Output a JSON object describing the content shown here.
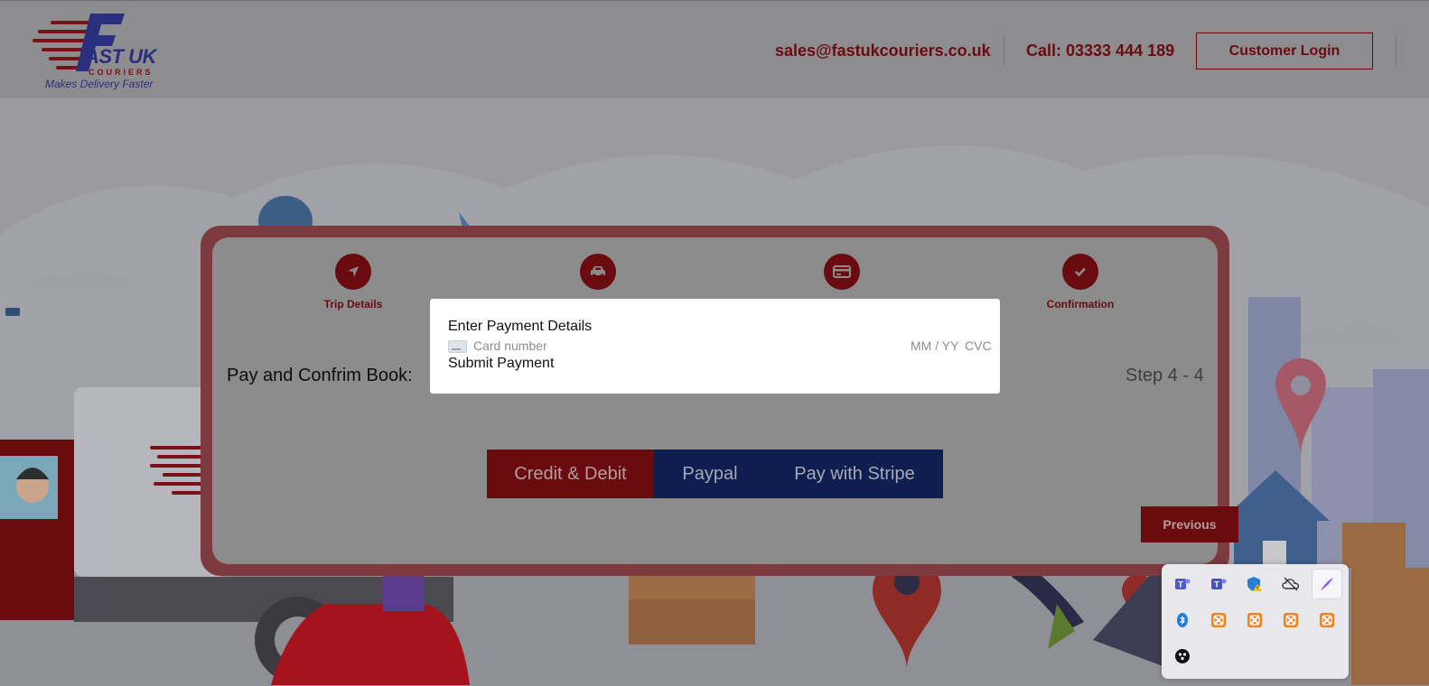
{
  "header": {
    "logo_brand": "AST UK",
    "logo_couriers": "COURIERS",
    "logo_tagline": "Makes Delivery Faster",
    "email": "sales@fastukcouriers.co.uk",
    "phone": "Call: 03333 444 189",
    "login_label": "Customer Login"
  },
  "steps": [
    {
      "label": "Trip Details",
      "icon": "location-arrow-icon"
    },
    {
      "label": "",
      "icon": "car-icon"
    },
    {
      "label": "",
      "icon": "credit-card-icon"
    },
    {
      "label": "Confirmation",
      "icon": "check-icon"
    }
  ],
  "booking": {
    "title": "Pay and Confrim Book:",
    "step_count": "Step 4 - 4",
    "tabs": [
      "Credit & Debit",
      "Paypal",
      "Pay with Stripe"
    ],
    "previous_label": "Previous"
  },
  "modal": {
    "title": "Enter Payment Details",
    "card_placeholder": "Card number",
    "expiry_placeholder": "MM / YY",
    "cvc_placeholder": "CVC",
    "submit_label": "Submit Payment"
  },
  "tray": {
    "icons": [
      "teams-icon",
      "teams-icon",
      "defender-warning-icon",
      "onedrive-offline-icon",
      "pen-icon",
      "bluetooth-icon",
      "xampp-icon",
      "xampp-icon",
      "xampp-icon",
      "xampp-icon",
      "app-icon"
    ]
  },
  "colors": {
    "brand_dark_red": "#6a0b0f",
    "brand_navy": "#0d1e4f",
    "overlay_gray": "#8c8c8c"
  }
}
